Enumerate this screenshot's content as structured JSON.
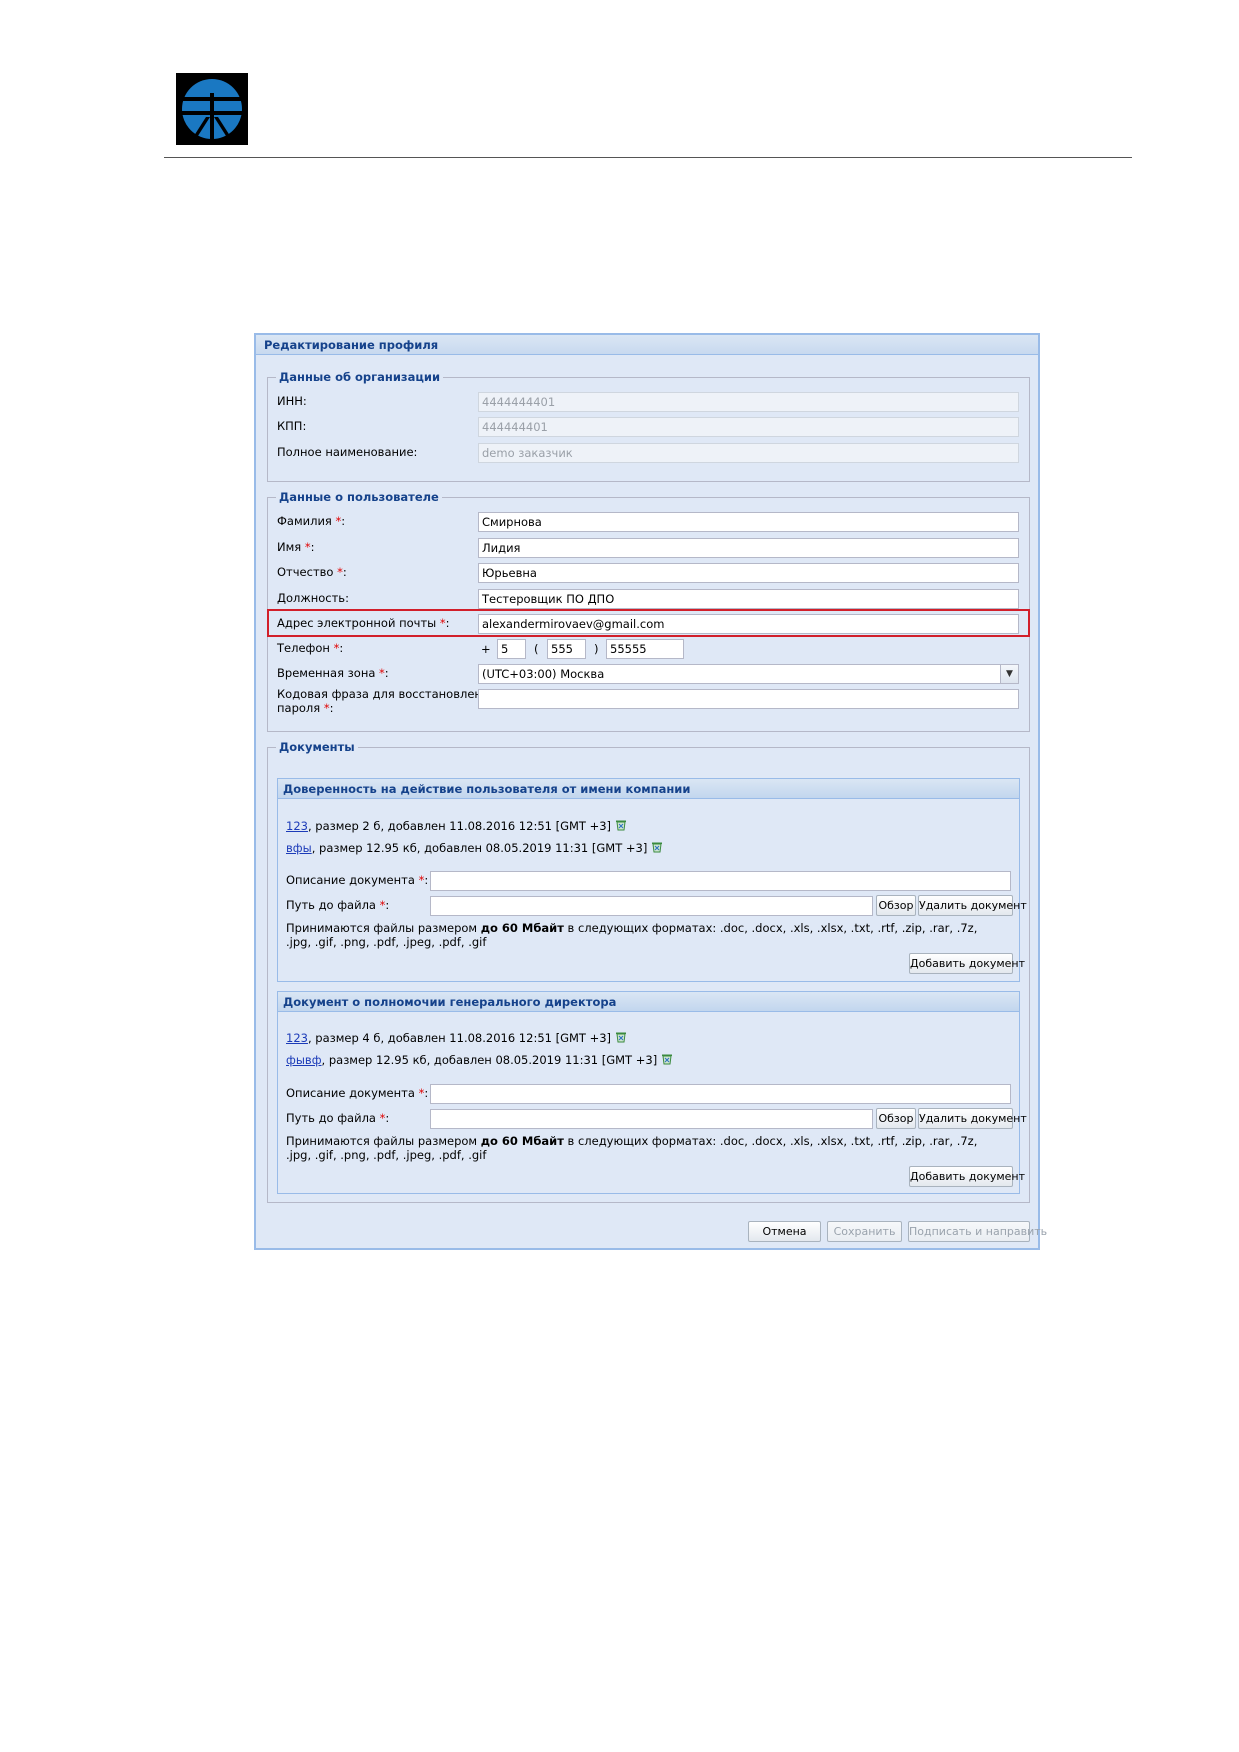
{
  "window": {
    "title": "Редактирование профиля"
  },
  "org": {
    "legend": "Данные об организации",
    "inn_label": "ИНН:",
    "inn_value": "4444444401",
    "kpp_label": "КПП:",
    "kpp_value": "444444401",
    "fullname_label": "Полное наименование:",
    "fullname_value": "demo заказчик"
  },
  "user": {
    "legend": "Данные о пользователе",
    "lastname_label": "Фамилия",
    "lastname_value": "Смирнова",
    "firstname_label": "Имя",
    "firstname_value": "Лидия",
    "middlename_label": "Отчество",
    "middlename_value": "Юрьевна",
    "position_label": "Должность:",
    "position_value": "Тестеровщик ПО ДПО",
    "email_label": "Адрес электронной почты",
    "email_value": "alexandermirovaev@gmail.com",
    "phone_label": "Телефон",
    "phone_plus": "+",
    "phone_country": "5",
    "phone_open": "(",
    "phone_code": "555",
    "phone_close": ")",
    "phone_number": "55555",
    "tz_label": "Временная зона",
    "tz_value": "(UTC+03:00) Москва",
    "code_label_1": "Кодовая фраза для восстановления",
    "code_label_2": "пароля",
    "code_value": "",
    "req_mark": "*",
    "colon": ":"
  },
  "docs": {
    "legend": "Документы",
    "common": {
      "desc_label": "Описание документа",
      "path_label": "Путь до файла",
      "browse": "Обзор",
      "delete": "Удалить документ",
      "add": "Добавить документ",
      "hint_prefix": "Принимаются файлы размером ",
      "hint_bold": "до 60 Мбайт",
      "hint_suffix": " в следующих форматах: .doc, .docx, .xls, .xlsx, .txt, .rtf, .zip, .rar, .7z, .jpg, .gif, .png, .pdf, .jpeg, .pdf, .gif"
    },
    "panels": [
      {
        "title": "Доверенность на действие пользователя от имени компании",
        "files": [
          {
            "name": "123",
            "info": ", размер 2 б, добавлен 11.08.2016 12:51 [GMT +3]"
          },
          {
            "name": "вфы",
            "info": ", размер 12.95 кб, добавлен 08.05.2019 11:31 [GMT +3]"
          }
        ]
      },
      {
        "title": "Документ о полномочии генерального директора",
        "files": [
          {
            "name": "123",
            "info": ", размер 4 б, добавлен 11.08.2016 12:51 [GMT +3]"
          },
          {
            "name": "фывф",
            "info": ", размер 12.95 кб, добавлен 08.05.2019 11:31 [GMT +3]"
          }
        ]
      }
    ]
  },
  "footer": {
    "cancel": "Отмена",
    "save": "Сохранить",
    "sign_send": "Подписать и направить"
  },
  "colors": {
    "window_bg": "#dfe8f6",
    "title_text": "#15428b",
    "highlight": "#d21f2a",
    "required": "#e00000",
    "link": "#1c3bb8"
  },
  "icons": {
    "logo": "company-logo",
    "file_delete": "trash-icon",
    "combo": "chevron-down-icon"
  }
}
